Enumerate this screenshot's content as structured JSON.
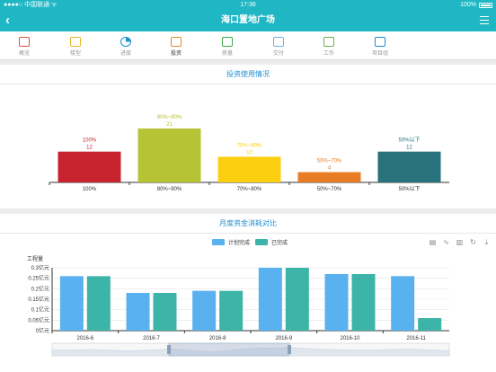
{
  "status_bar": {
    "carrier": "●●●●○ 中国联通 ᯤ",
    "time": "17:36",
    "battery": "100%"
  },
  "header": {
    "title": "海口置地广场"
  },
  "tabs": [
    {
      "label": "概览",
      "icon": "overview-icon",
      "color": "#e0533d"
    },
    {
      "label": "楼型",
      "icon": "building-icon",
      "color": "#e8b52a"
    },
    {
      "label": "进度",
      "icon": "progress-pie-icon",
      "color": "#1f8fd1"
    },
    {
      "label": "投资",
      "icon": "investment-box-icon",
      "color": "#e08a2a"
    },
    {
      "label": "质量",
      "icon": "quality-shield-icon",
      "color": "#3aa84a"
    },
    {
      "label": "交付",
      "icon": "delivery-icon",
      "color": "#7ab2e0"
    },
    {
      "label": "工作",
      "icon": "work-briefcase-icon",
      "color": "#6ab04c"
    },
    {
      "label": "项目组",
      "icon": "team-icon",
      "color": "#1f8fd1"
    }
  ],
  "invest_usage": {
    "title": "投资使用情况",
    "chart_data": {
      "type": "bar",
      "categories": [
        "100%",
        "80%~90%",
        "70%~80%",
        "50%~70%",
        "50%以下"
      ],
      "values": [
        12,
        21,
        10,
        4,
        12
      ],
      "labels_top": [
        "100%",
        "80%~90%",
        "70%~80%",
        "50%~70%",
        "50%以下"
      ],
      "colors": [
        "#c8242f",
        "#b5c334",
        "#fcce10",
        "#e87c25",
        "#27727b"
      ]
    }
  },
  "monthly": {
    "title": "月度资金消耗对比",
    "legend": [
      {
        "name": "计划完成",
        "color": "#5ab1ef"
      },
      {
        "name": "已完成",
        "color": "#3cb4a8"
      }
    ],
    "chart_data": {
      "type": "bar",
      "ylabel": "工程量",
      "y_ticks": [
        "0.3亿元",
        "0.25亿元",
        "0.2亿元",
        "0.15亿元",
        "0.1亿元",
        "0.05亿元",
        "0亿元"
      ],
      "ylim": [
        0,
        0.3
      ],
      "categories": [
        "2016-6",
        "2016-7",
        "2016-8",
        "2016-9",
        "2016-10",
        "2016-11"
      ],
      "series": [
        {
          "name": "计划完成",
          "values": [
            0.26,
            0.18,
            0.19,
            0.3,
            0.27,
            0.26
          ]
        },
        {
          "name": "已完成",
          "values": [
            0.26,
            0.18,
            0.19,
            0.3,
            0.27,
            0.06
          ]
        }
      ]
    },
    "tools": [
      "data-view-icon",
      "line-chart-icon",
      "bar-chart-icon",
      "refresh-icon",
      "download-icon"
    ]
  }
}
